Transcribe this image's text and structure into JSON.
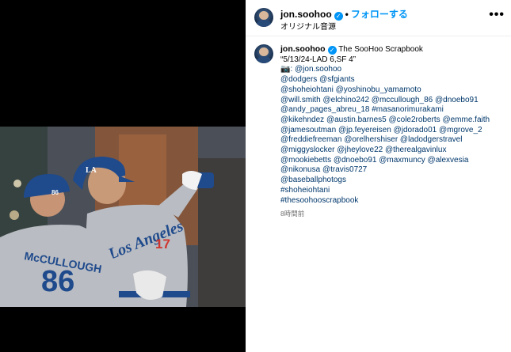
{
  "header": {
    "username": "jon.soohoo",
    "verified_glyph": "✓",
    "separator": "•",
    "follow_label": "フォローする",
    "audio_label": "オリジナル音源",
    "more_icon": "more-horizontal-icon",
    "more_glyph": "•••"
  },
  "caption": {
    "username": "jon.soohoo",
    "title": "The SooHoo Scrapbook",
    "lines": [
      "“5/13/24-LAD 6,SF 4”",
      "📷: @jon.soohoo",
      "@dodgers @sfgiants",
      "@shoheiohtani @yoshinobu_yamamoto",
      "@will.smith @elchino242 @mccullough_86 @dnoebo91",
      "@andy_pages_abreu_18 #masanorimurakami",
      "@kikehndez @austin.barnes5 @cole2roberts @emme.faith",
      "@jamesoutman @jp.feyereisen @jdorado01 @mgrove_2",
      "@freddiefreeman @orelhershiser @ladodgerstravel",
      "@miggyslocker @jheylove22 @therealgavinlux",
      "@mookiebetts @dnoebo91 @maxmuncy @alexvesia",
      "@nikonusa @travis0727",
      "@baseballphotogs",
      "#shoheiohtani",
      "#thesoohooscrapbook"
    ],
    "timestamp": "8時間前"
  },
  "photo": {
    "coach_jersey_name": "McCULLOUGH",
    "coach_jersey_number": "86",
    "coach_helmet_number": "86",
    "player_jersey_script": "Los Angeles",
    "player_jersey_number": "17",
    "helmet_logo": "LA"
  },
  "colors": {
    "link": "#00376b",
    "follow": "#0095f6",
    "dodger_blue": "#1f4a8c",
    "road_grey": "#b9bcc2",
    "jersey_red": "#d0362f"
  }
}
